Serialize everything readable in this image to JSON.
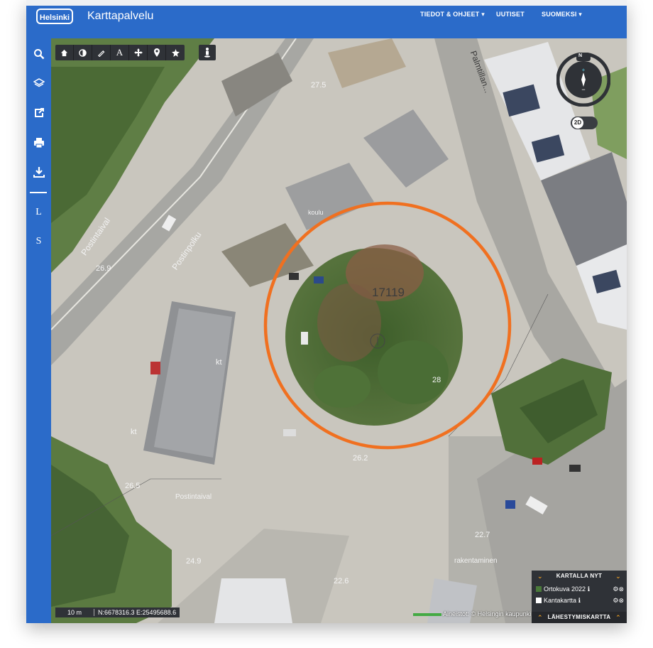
{
  "header": {
    "logo": "Helsinki",
    "title": "Karttapalvelu",
    "nav": [
      "TIEDOT & OHJEET ▾",
      "UUTISET",
      "SUOMEKSI ▾"
    ]
  },
  "sidebar": {
    "items": [
      {
        "icon": "search-icon"
      },
      {
        "icon": "layers-icon"
      },
      {
        "icon": "share-icon"
      },
      {
        "icon": "print-icon"
      },
      {
        "icon": "download-icon"
      },
      {
        "label": "L"
      },
      {
        "label": "S"
      }
    ]
  },
  "toolbar": {
    "tools": [
      "home-icon",
      "contrast-icon",
      "measure-icon",
      "text-tool-icon",
      "move-icon",
      "marker-icon",
      "shape-icon"
    ],
    "text_tool_label": "A",
    "extra": "pedestrian-icon"
  },
  "map": {
    "parcel_label": "17119",
    "labels": [
      "27.5",
      "26.9",
      "26.5",
      "24.9",
      "22.6",
      "26.2",
      "22.7",
      "28",
      "kt",
      "kt",
      "koulu",
      "rakentaminen"
    ],
    "street_labels": [
      "Postintaival",
      "Postinpolku",
      "Postintaival",
      "Palmtillan..."
    ],
    "circle_color": "#f07020"
  },
  "compass": {
    "north_label": "N",
    "mode_label": "2D"
  },
  "scale": {
    "label": "10 m",
    "coords": "N:6678316.3 E:25495688.6"
  },
  "attribution": "Aineistot: © Helsingin kaupunki",
  "layers_panel": {
    "header": "KARTALLA NYT",
    "rows": [
      {
        "label": "Ortokuva 2022",
        "checked": true
      },
      {
        "label": "Kantakartta",
        "checked": false
      }
    ],
    "footer": "LÄHESTYMISKARTTA",
    "accent": "#f0a020"
  },
  "colors": {
    "brand": "#2b6bc9",
    "toolbar": "#2f3237"
  }
}
